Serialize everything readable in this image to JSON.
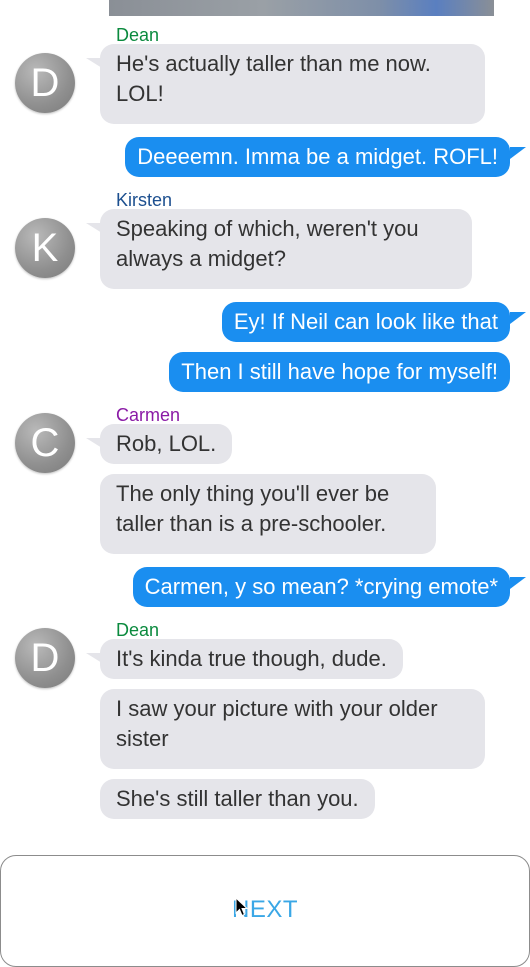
{
  "colors": {
    "dean": "#0b8a3e",
    "kirsten": "#1c4f8f",
    "carmen": "#8a1aa6",
    "outgoing_bubble": "#1a8ef0",
    "incoming_bubble": "#e5e5ea",
    "next": "#3aa7e6"
  },
  "icons": {
    "cursor": "arrow-cursor-icon"
  },
  "chat": {
    "group1": {
      "avatar": "D",
      "name": "Dean",
      "messages": [
        "He's actually taller than me now. LOL!"
      ]
    },
    "out1": "Deeeemn. Imma be a midget. ROFL!",
    "group2": {
      "avatar": "K",
      "name": "Kirsten",
      "messages": [
        "Speaking of which, weren't you always a midget?"
      ]
    },
    "out2": "Ey! If Neil can look like that",
    "out3": "Then I still have hope for myself!",
    "group3": {
      "avatar": "C",
      "name": "Carmen",
      "messages": [
        "Rob, LOL.",
        "The only thing you'll ever be taller than is a pre-schooler."
      ]
    },
    "out4": "Carmen, y so mean? *crying emote*",
    "group4": {
      "avatar": "D",
      "name": "Dean",
      "messages": [
        "It's kinda true though, dude.",
        "I saw your picture with your older sister",
        "She's still taller than you."
      ]
    }
  },
  "footer": {
    "next_label": "NEXT"
  }
}
